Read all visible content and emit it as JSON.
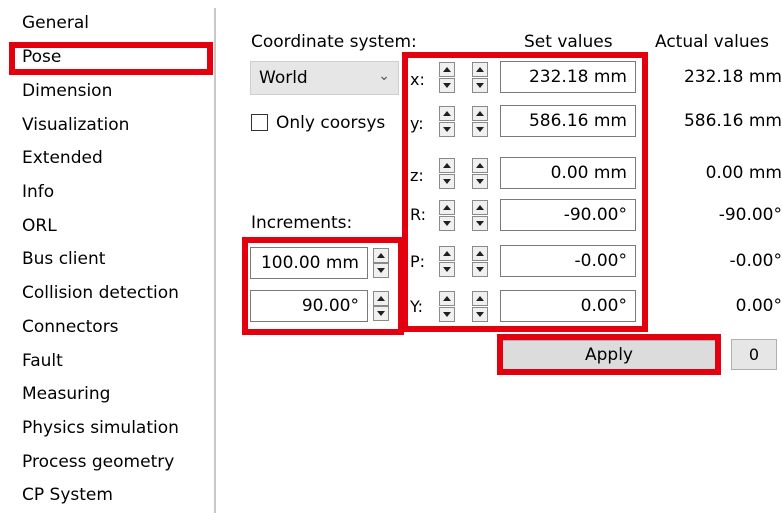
{
  "sidebar": {
    "items": [
      {
        "label": "General"
      },
      {
        "label": "Pose"
      },
      {
        "label": "Dimension"
      },
      {
        "label": "Visualization"
      },
      {
        "label": "Extended"
      },
      {
        "label": "Info"
      },
      {
        "label": "ORL"
      },
      {
        "label": "Bus client"
      },
      {
        "label": "Collision detection"
      },
      {
        "label": "Connectors"
      },
      {
        "label": "Fault"
      },
      {
        "label": "Measuring"
      },
      {
        "label": "Physics simulation"
      },
      {
        "label": "Process geometry"
      },
      {
        "label": "CP System"
      }
    ],
    "selected": "Pose"
  },
  "pose": {
    "coordinate_system_label": "Coordinate system:",
    "coordinate_system_value": "World",
    "only_coorsys_label": "Only coorsys",
    "only_coorsys_checked": false,
    "set_values_header": "Set values",
    "actual_values_header": "Actual values",
    "increments_label": "Increments:",
    "increment_linear": "100.00 mm",
    "increment_angular": "90.00°",
    "axes": [
      {
        "label": "x:",
        "set": "232.18 mm",
        "actual": "232.18 mm"
      },
      {
        "label": "y:",
        "set": "586.16 mm",
        "actual": "586.16 mm"
      },
      {
        "label": "z:",
        "set": "0.00 mm",
        "actual": "0.00 mm"
      },
      {
        "label": "R:",
        "set": "-90.00°",
        "actual": "-90.00°"
      },
      {
        "label": "P:",
        "set": "-0.00°",
        "actual": "-0.00°"
      },
      {
        "label": "Y:",
        "set": "0.00°",
        "actual": "0.00°"
      }
    ],
    "apply_label": "Apply",
    "zero_label": "0"
  },
  "colors": {
    "highlight": "#e3000f",
    "control_bg": "#e6e6e6"
  }
}
